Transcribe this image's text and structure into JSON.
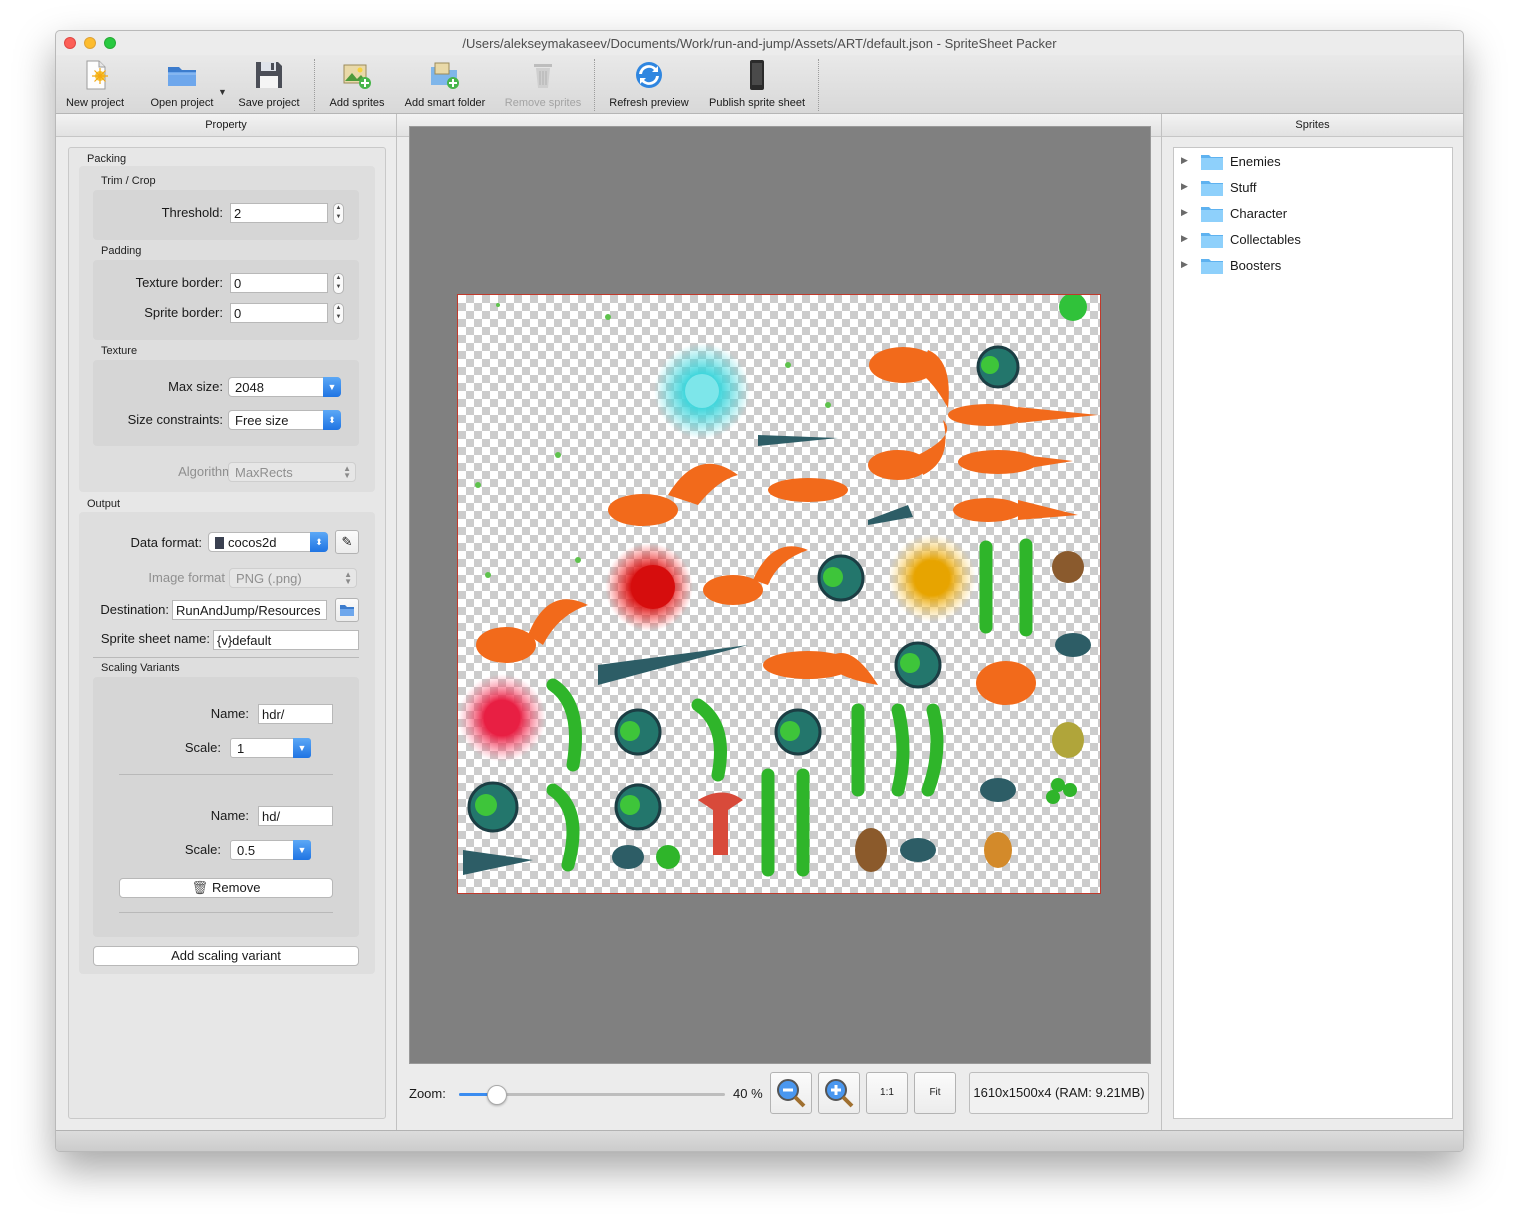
{
  "window": {
    "title": "/Users/alekseymakaseev/Documents/Work/run-and-jump/Assets/ART/default.json - SpriteSheet Packer"
  },
  "toolbar": {
    "new_project": "New project",
    "open_project": "Open project",
    "save_project": "Save project",
    "add_sprites": "Add sprites",
    "add_smart_folder": "Add smart folder",
    "remove_sprites": "Remove sprites",
    "refresh_preview": "Refresh preview",
    "publish_sprite_sheet": "Publish sprite sheet"
  },
  "property_panel": {
    "header": "Property",
    "packing": {
      "title": "Packing",
      "trim_crop": {
        "title": "Trim / Crop",
        "threshold_label": "Threshold:",
        "threshold_value": "2"
      },
      "padding": {
        "title": "Padding",
        "texture_border_label": "Texture border:",
        "texture_border_value": "0",
        "sprite_border_label": "Sprite border:",
        "sprite_border_value": "0"
      },
      "texture": {
        "title": "Texture",
        "max_size_label": "Max size:",
        "max_size_value": "2048",
        "size_constraints_label": "Size constraints:",
        "size_constraints_value": "Free size"
      },
      "algorithm_label": "Algorithm",
      "algorithm_value": "MaxRects"
    },
    "output": {
      "title": "Output",
      "data_format_label": "Data format:",
      "data_format_value": "cocos2d",
      "image_format_label": "Image format",
      "image_format_value": "PNG (.png)",
      "destination_label": "Destination:",
      "destination_value": "RunAndJump/Resources",
      "sprite_sheet_name_label": "Sprite sheet name:",
      "sprite_sheet_name_value": "{v}default",
      "scaling_variants": {
        "title": "Scaling Variants",
        "variants": [
          {
            "name_label": "Name:",
            "name_value": "hdr/",
            "scale_label": "Scale:",
            "scale_value": "1"
          },
          {
            "name_label": "Name:",
            "name_value": "hd/",
            "scale_label": "Scale:",
            "scale_value": "0.5"
          }
        ],
        "remove_label": "Remove"
      },
      "add_scaling_variant_label": "Add scaling variant"
    }
  },
  "preview": {
    "zoom_label": "Zoom:",
    "zoom_percent": 40,
    "zoom_text": "40 %",
    "zoom_slider_value": 0.14,
    "one_to_one_label": "1:1",
    "fit_label": "Fit",
    "info": "1610x1500x4 (RAM: 9.21MB)"
  },
  "sprites_panel": {
    "header": "Sprites",
    "folders": [
      "Enemies",
      "Stuff",
      "Character",
      "Collectables",
      "Boosters"
    ]
  },
  "colors": {
    "accent_blue": "#2a7be6",
    "folder_blue": "#6fc0f7",
    "canvas_gray": "#808080",
    "squirrel_orange": "#f26a1b",
    "caterpillar_green": "#2fb52a",
    "spider_teal": "#1f6e6a"
  }
}
